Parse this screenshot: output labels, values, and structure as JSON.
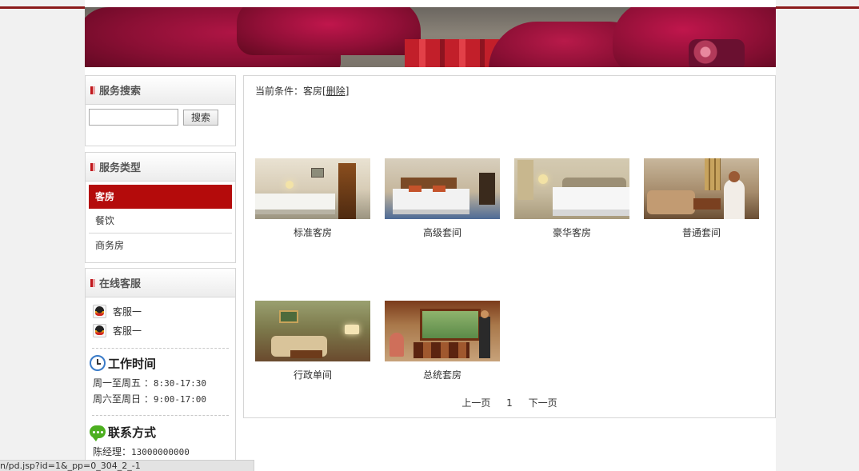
{
  "sidebar": {
    "search": {
      "title": "服务搜索",
      "input_value": "",
      "button_label": "搜索"
    },
    "types": {
      "title": "服务类型",
      "items": [
        {
          "label": "客房",
          "active": true
        },
        {
          "label": "餐饮",
          "active": false
        },
        {
          "label": "商务房",
          "active": false
        }
      ]
    },
    "service": {
      "title": "在线客服",
      "agents": [
        {
          "label": "客服一",
          "icon": "qq-icon"
        },
        {
          "label": "客服一",
          "icon": "qq-icon"
        }
      ],
      "hours": {
        "title": "工作时间",
        "lines": [
          {
            "label": "周一至周五 ：",
            "value": "8:30-17:30"
          },
          {
            "label": "周六至周日 ：",
            "value": "9:00-17:00"
          }
        ]
      },
      "contact": {
        "title": "联系方式",
        "lines": [
          {
            "label": "陈经理：",
            "value": "13000000000"
          }
        ]
      }
    }
  },
  "main": {
    "condition": {
      "prefix": "当前条件：客房[",
      "remove_link": "删除",
      "suffix": "]"
    },
    "rooms": [
      {
        "caption": "标准客房"
      },
      {
        "caption": "高级套间"
      },
      {
        "caption": "豪华客房"
      },
      {
        "caption": "普通套间"
      },
      {
        "caption": "行政单间"
      },
      {
        "caption": "总统套房"
      }
    ],
    "pager": {
      "prev": "上一页",
      "current": "1",
      "next": "下一页"
    }
  },
  "status_bar": {
    "url": "n/pd.jsp?id=1&_pp=0_304_2_-1"
  },
  "colors": {
    "active_item": "#b40b0b",
    "top_line": "#8b1a1a",
    "accent_blue": "#3c8fd6"
  }
}
